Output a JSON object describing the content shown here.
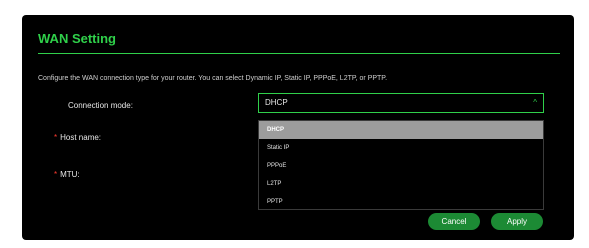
{
  "section": {
    "title": "WAN Setting",
    "description": "Configure the WAN connection type for your router. You can select Dynamic IP, Static IP, PPPoE, L2TP, or PPTP."
  },
  "fields": {
    "connection_mode_label": "Connection mode:",
    "host_name_label": "Host name:",
    "mtu_label": "MTU:",
    "required_mark": "*"
  },
  "connection_select": {
    "value": "DHCP",
    "caret": "^"
  },
  "dropdown": {
    "options": [
      "DHCP",
      "Static IP",
      "PPPoE",
      "L2TP",
      "PPTP"
    ],
    "highlighted": "DHCP"
  },
  "buttons": {
    "cancel": "Cancel",
    "apply": "Apply"
  },
  "colors": {
    "accent": "#2fd04a",
    "background": "#000000",
    "button": "#1c8a34",
    "required": "#ff3b30",
    "option_highlight": "#9c9c9c"
  },
  "icons": {
    "select_caret": "chevron-up-icon"
  }
}
